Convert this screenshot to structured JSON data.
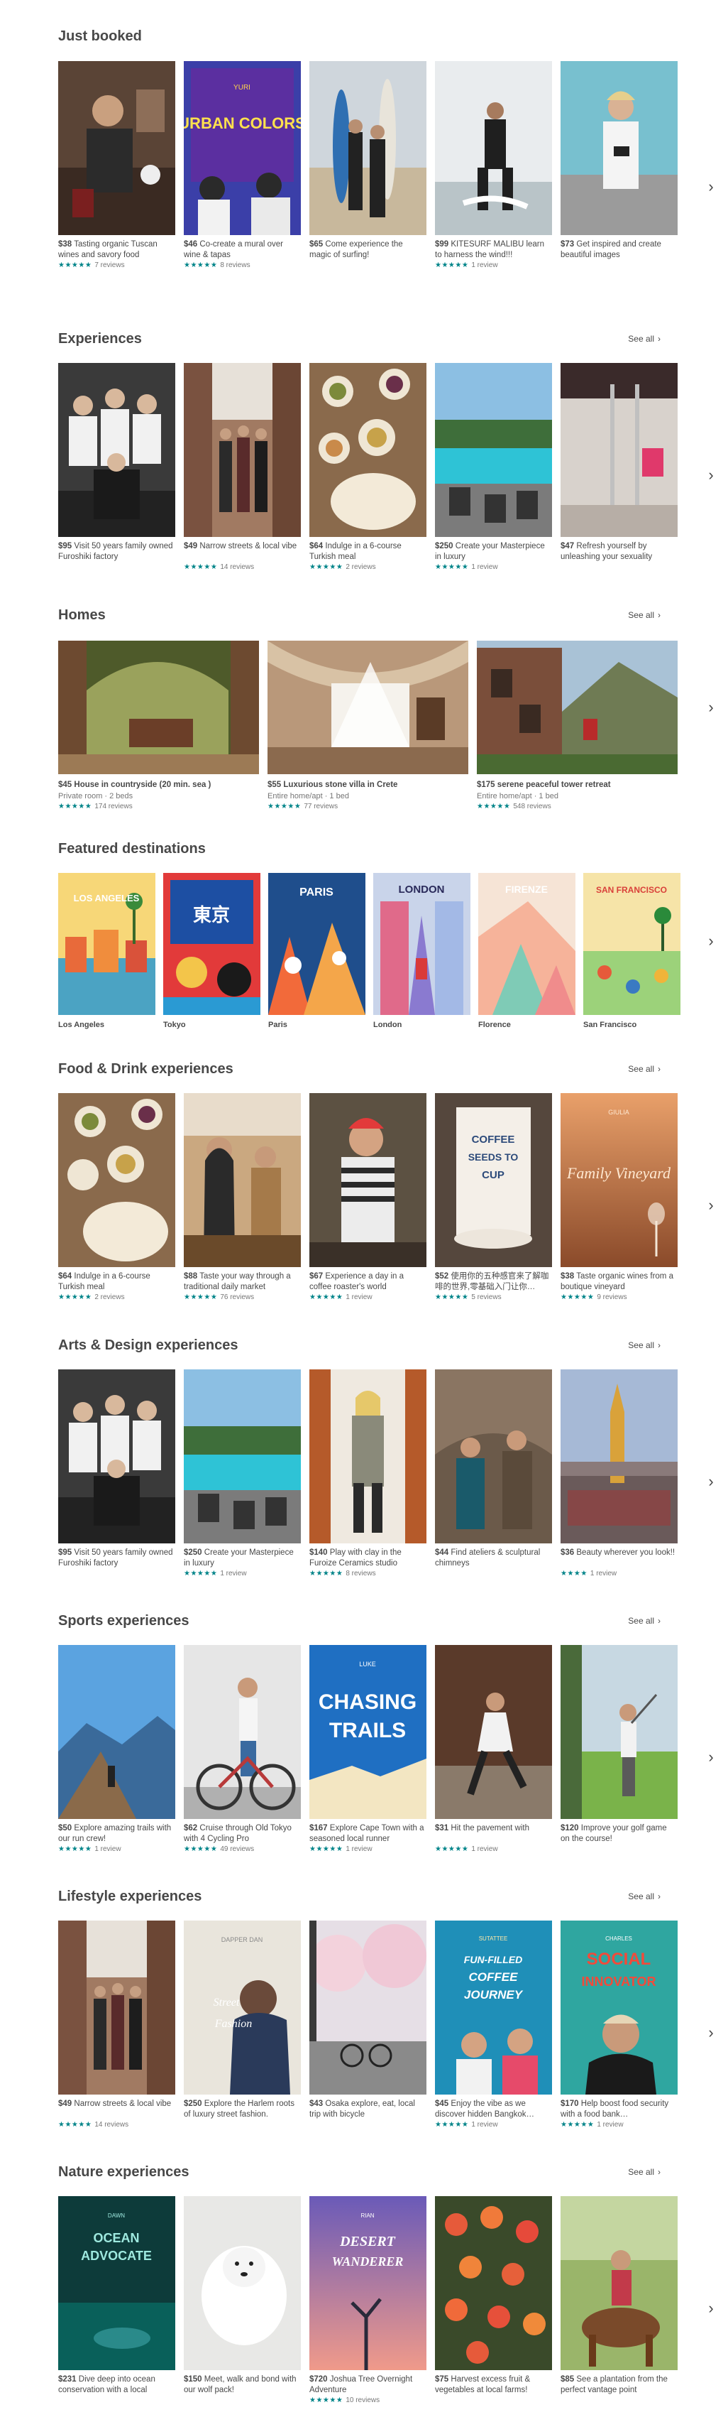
{
  "sections": {
    "just_booked": {
      "title": "Just booked",
      "cards": [
        {
          "price": "$38",
          "text": "Tasting organic Tuscan wines and savory food",
          "stars": "★★★★★",
          "reviews": "7 reviews"
        },
        {
          "price": "$46",
          "text": "Co-create a mural over wine & tapas",
          "stars": "★★★★★",
          "reviews": "8 reviews"
        },
        {
          "price": "$65",
          "text": "Come experience the magic of surfing!",
          "stars": "",
          "reviews": ""
        },
        {
          "price": "$99",
          "text": "KITESURF MALIBU learn to harness the wind!!!",
          "stars": "★★★★★",
          "reviews": "1 review"
        },
        {
          "price": "$73",
          "text": "Get inspired and create beautiful images",
          "stars": "",
          "reviews": ""
        }
      ]
    },
    "experiences": {
      "title": "Experiences",
      "see_all": "See all",
      "cards": [
        {
          "price": "$95",
          "text": "Visit 50 years family owned Furoshiki factory",
          "stars": "",
          "reviews": ""
        },
        {
          "price": "$49",
          "text": "Narrow streets & local vibe",
          "stars": "★★★★★",
          "reviews": "14 reviews"
        },
        {
          "price": "$64",
          "text": "Indulge in a 6-course Turkish meal",
          "stars": "★★★★★",
          "reviews": "2 reviews"
        },
        {
          "price": "$250",
          "text": "Create your Masterpiece in luxury",
          "stars": "★★★★★",
          "reviews": "1 review"
        },
        {
          "price": "$47",
          "text": "Refresh yourself by unleashing your sexuality",
          "stars": "",
          "reviews": ""
        }
      ]
    },
    "homes": {
      "title": "Homes",
      "see_all": "See all",
      "cards": [
        {
          "price": "$45",
          "text": "House in countryside (20 min. sea )",
          "sub": "Private room · 2 beds",
          "stars": "★★★★★",
          "reviews": "174 reviews"
        },
        {
          "price": "$55",
          "text": "Luxurious stone villa in Crete",
          "sub": "Entire home/apt · 1 bed",
          "stars": "★★★★★",
          "reviews": "77 reviews"
        },
        {
          "price": "$175",
          "text": "serene peaceful tower retreat",
          "sub": "Entire home/apt · 1 bed",
          "stars": "★★★★★",
          "reviews": "548 reviews"
        }
      ]
    },
    "featured": {
      "title": "Featured destinations",
      "cards": [
        {
          "name": "Los Angeles",
          "poster": "LOS ANGELES"
        },
        {
          "name": "Tokyo",
          "poster": "東京"
        },
        {
          "name": "Paris",
          "poster": "PARIS"
        },
        {
          "name": "London",
          "poster": "LONDON"
        },
        {
          "name": "Florence",
          "poster": "FIRENZE"
        },
        {
          "name": "San Francisco",
          "poster": "SAN FRANCISCO"
        }
      ]
    },
    "food": {
      "title": "Food & Drink experiences",
      "see_all": "See all",
      "cards": [
        {
          "price": "$64",
          "text": "Indulge in a 6-course Turkish meal",
          "stars": "★★★★★",
          "reviews": "2 reviews"
        },
        {
          "price": "$88",
          "text": "Taste your way through a traditional daily market",
          "stars": "★★★★★",
          "reviews": "76 reviews"
        },
        {
          "price": "$67",
          "text": "Experience a day in a coffee roaster's world",
          "stars": "★★★★★",
          "reviews": "1 review"
        },
        {
          "price": "$52",
          "text": "使用你的五种感官来了解咖啡的世界,零基础入门让你…",
          "stars": "★★★★★",
          "reviews": "5 reviews"
        },
        {
          "price": "$38",
          "text": "Taste organic wines from a boutique vineyard",
          "stars": "★★★★★",
          "reviews": "9 reviews"
        }
      ]
    },
    "arts": {
      "title": "Arts & Design experiences",
      "see_all": "See all",
      "cards": [
        {
          "price": "$95",
          "text": "Visit 50 years family owned Furoshiki factory",
          "stars": "",
          "reviews": ""
        },
        {
          "price": "$250",
          "text": "Create your Masterpiece in luxury",
          "stars": "★★★★★",
          "reviews": "1 review"
        },
        {
          "price": "$140",
          "text": "Play with clay in the Furoize Ceramics studio",
          "stars": "★★★★★",
          "reviews": "8 reviews"
        },
        {
          "price": "$44",
          "text": "Find ateliers & sculptural chimneys",
          "stars": "",
          "reviews": ""
        },
        {
          "price": "$36",
          "text": "Beauty wherever you look!!",
          "stars": "★★★★",
          "reviews": "1 review"
        }
      ]
    },
    "sports": {
      "title": "Sports experiences",
      "see_all": "See all",
      "cards": [
        {
          "price": "$50",
          "text": "Explore amazing trails with our run crew!",
          "stars": "★★★★★",
          "reviews": "1 review"
        },
        {
          "price": "$62",
          "text": "Cruise through Old Tokyo with 4 Cycling Pro",
          "stars": "★★★★★",
          "reviews": "49 reviews"
        },
        {
          "price": "$167",
          "text": "Explore Cape Town with a seasoned local runner",
          "stars": "★★★★★",
          "reviews": "1 review"
        },
        {
          "price": "$31",
          "text": "Hit the pavement with ",
          "stars": "★★★★★",
          "reviews": "1 review"
        },
        {
          "price": "$120",
          "text": "Improve your golf game on the course!",
          "stars": "",
          "reviews": ""
        }
      ]
    },
    "lifestyle": {
      "title": "Lifestyle experiences",
      "see_all": "See all",
      "cards": [
        {
          "price": "$49",
          "text": "Narrow streets & local vibe",
          "stars": "★★★★★",
          "reviews": "14 reviews"
        },
        {
          "price": "$250",
          "text": "Explore the Harlem roots of luxury street fashion.",
          "stars": "",
          "reviews": ""
        },
        {
          "price": "$43",
          "text": "Osaka explore, eat, local trip with bicycle",
          "stars": "",
          "reviews": ""
        },
        {
          "price": "$45",
          "text": "Enjoy the vibe as we discover hidden Bangkok…",
          "stars": "★★★★★",
          "reviews": "1 review"
        },
        {
          "price": "$170",
          "text": "Help boost food security with a food bank…",
          "stars": "★★★★★",
          "reviews": "1 review"
        }
      ]
    },
    "nature": {
      "title": "Nature experiences",
      "see_all": "See all",
      "cards": [
        {
          "price": "$231",
          "text": "Dive deep into ocean conservation with a local",
          "stars": "",
          "reviews": ""
        },
        {
          "price": "$150",
          "text": "Meet, walk and bond with our wolf pack!",
          "stars": "",
          "reviews": ""
        },
        {
          "price": "$720",
          "text": "Joshua Tree Overnight Adventure",
          "stars": "★★★★★",
          "reviews": "10 reviews"
        },
        {
          "price": "$75",
          "text": "Harvest excess fruit & vegetables at local farms!",
          "stars": "",
          "reviews": ""
        },
        {
          "price": "$85",
          "text": "See a plantation from the perfect vantage point",
          "stars": "",
          "reviews": ""
        }
      ]
    }
  },
  "posters": {
    "urban_colors": "URBAN COLORS",
    "yuri": "YURI",
    "coffee": "COFFEE SEEDS TO CUP",
    "family_vineyard": "Family Vineyard",
    "giulia": "GIULIA",
    "chasing_trails": "CHASING TRAILS",
    "luke": "LUKE",
    "street_fashion": "Street Fashion",
    "dapper_dan": "DAPPER DAN",
    "coffee_journey": "FUN-FILLED COFFEE JOURNEY",
    "sutattee": "SUTATTEE",
    "social_innovator": "SOCIAL INNOVATOR",
    "charles": "CHARLES",
    "ocean_advocate": "OCEAN ADVOCATE",
    "dawn": "DAWN",
    "desert_wanderer": "DESERT WANDERER",
    "rian": "RIAN"
  },
  "icons": {
    "next": "chevron-right-icon"
  },
  "colors": {
    "accent": "#008489",
    "text": "#484848",
    "muted": "#767676"
  }
}
